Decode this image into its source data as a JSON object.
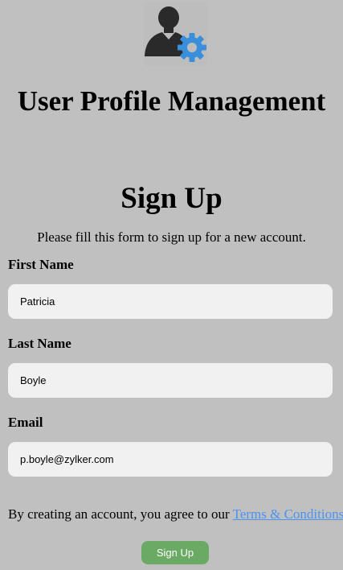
{
  "app": {
    "title": "User Profile Management",
    "logo_icon": "user-gear-icon"
  },
  "form": {
    "title": "Sign Up",
    "subtitle": "Please fill this form to sign up for a new account.",
    "fields": [
      {
        "label": "First Name",
        "value": "Patricia"
      },
      {
        "label": "Last Name",
        "value": "Boyle"
      },
      {
        "label": "Email",
        "value": "p.boyle@zylker.com"
      }
    ],
    "terms_prefix": "By creating an account, you agree to our ",
    "terms_link": "Terms & Conditions",
    "terms_suffix": ".",
    "submit_label": "Sign Up"
  },
  "colors": {
    "background": "#c0c0c0",
    "input_background": "#f1f1f1",
    "link": "#4b93ef",
    "button": "#6aaa65",
    "gear": "#3a8fdc"
  }
}
